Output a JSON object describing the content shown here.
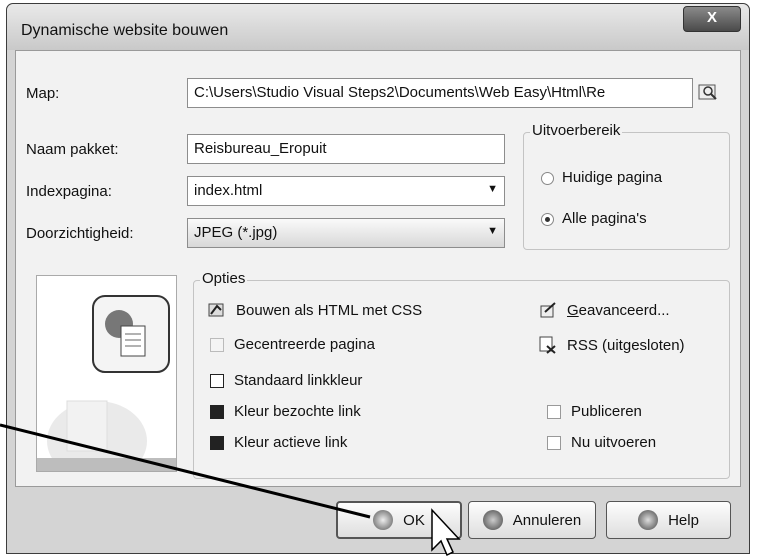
{
  "window": {
    "title": "Dynamische website bouwen",
    "close_label": "X"
  },
  "form": {
    "map_label": "Map:",
    "map_value": "C:\\Users\\Studio Visual Steps2\\Documents\\Web Easy\\Html\\Re",
    "pakket_label": "Naam pakket:",
    "pakket_value": "Reisbureau_Eropuit",
    "index_label": "Indexpagina:",
    "index_value": "index.html",
    "transparency_label": "Doorzichtigheid:",
    "transparency_value": "JPEG (*.jpg)"
  },
  "output_range": {
    "title": "Uitvoerbereik",
    "options": [
      "Huidige pagina",
      "Alle pagina's"
    ],
    "selected": "Alle pagina's"
  },
  "options": {
    "title": "Opties",
    "build_html_css": "Bouwen als HTML met CSS",
    "centered_page": "Gecentreerde pagina",
    "default_link_color": "Standaard linkkleur",
    "visited_link_color": "Kleur bezochte link",
    "active_link_color": "Kleur actieve link",
    "advanced_prefix": "G",
    "advanced_rest": "eavanceerd...",
    "rss": "RSS (uitgesloten)",
    "publish": "Publiceren",
    "run_now": "Nu uitvoeren"
  },
  "buttons": {
    "ok": "OK",
    "cancel": "Annuleren",
    "help": "Help"
  },
  "icons": [
    "browse-icon",
    "html-css-icon",
    "rss-icon",
    "advanced-icon",
    "ok-icon",
    "cancel-icon",
    "help-icon",
    "mouse-cursor-icon"
  ]
}
